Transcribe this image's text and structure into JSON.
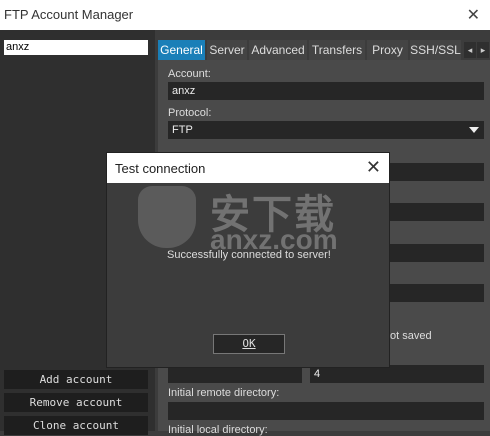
{
  "window": {
    "title": "FTP Account Manager",
    "close_glyph": "✕"
  },
  "accounts": {
    "items": [
      "anxz"
    ]
  },
  "left_buttons": {
    "add": "Add account",
    "remove": "Remove account",
    "clone": "Clone account"
  },
  "tabs": [
    "General",
    "Server",
    "Advanced",
    "Transfers",
    "Proxy",
    "SSH/SSL"
  ],
  "tab_nav": {
    "prev": "◂",
    "next": "▸"
  },
  "general": {
    "account_label": "Account:",
    "account_value": "anxz",
    "protocol_label": "Protocol:",
    "protocol_value": "FTP",
    "not_saved_note": "ot saved",
    "port_value": "4",
    "initial_remote_label": "Initial remote directory:",
    "initial_local_label": "Initial local directory:"
  },
  "dialog": {
    "title": "Test connection",
    "close_glyph": "✕",
    "message": "Successfully connected to server!",
    "ok_label": "OK"
  },
  "watermark": {
    "text": "安下载",
    "sub": "anxz.com"
  }
}
